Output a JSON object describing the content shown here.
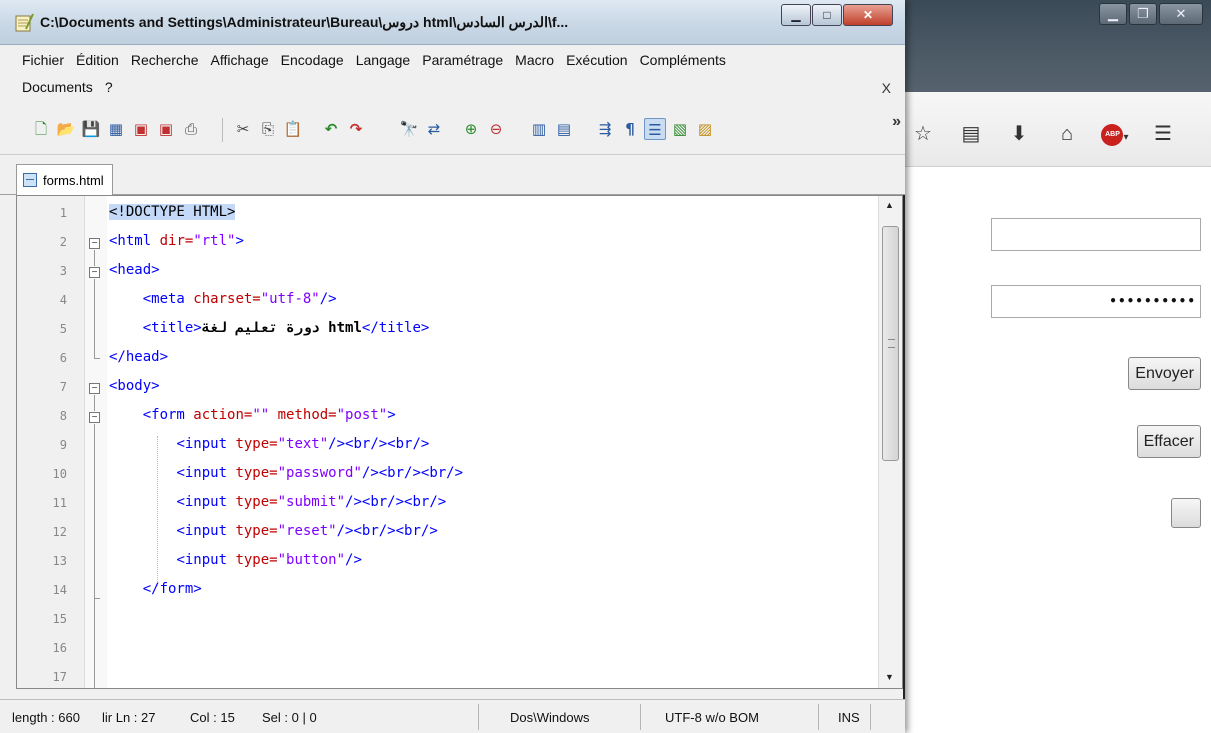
{
  "npp": {
    "title": "C:\\Documents and Settings\\Administrateur\\Bureau\\دروس html\\الدرس السادس\\f...",
    "menu_row1": [
      "Fichier",
      "Édition",
      "Recherche",
      "Affichage",
      "Encodage",
      "Langage",
      "Paramétrage",
      "Macro",
      "Exécution",
      "Compléments"
    ],
    "menu_row2": [
      "Documents",
      "?"
    ],
    "menu_close": "X",
    "toolbar_more": "»",
    "tab_label": "forms.html",
    "line_numbers": [
      "1",
      "2",
      "3",
      "4",
      "5",
      "6",
      "7",
      "8",
      "9",
      "10",
      "11",
      "12",
      "13",
      "14",
      "15",
      "16",
      "17"
    ],
    "code": {
      "l1": {
        "doctype": "<!DOCTYPE HTML>"
      },
      "l2": {
        "tag_open": "<html",
        "attr": " dir=",
        "val": "\"rtl\"",
        "tag_close": ">"
      },
      "l3": {
        "tag": "<head>"
      },
      "l4": {
        "tag_open": "<meta",
        "attr": " charset=",
        "val": "\"utf-8\"",
        "tag_close": "/>"
      },
      "l5": {
        "tag_open": "<title>",
        "text": "دورة تعليم لغة html",
        "tag_close": "</title>"
      },
      "l6": {
        "tag": "</head>"
      },
      "l7": {
        "tag": "<body>"
      },
      "l8": {
        "tag_open": "<form",
        "attr1": " action=",
        "val1": "\"\"",
        "attr2": " method=",
        "val2": "\"post\"",
        "tag_close": ">"
      },
      "l9": {
        "tag_open": "<input",
        "attr": " type=",
        "val": "\"text\"",
        "tag_close": "/><br/><br/>"
      },
      "l10": {
        "tag_open": "<input",
        "attr": " type=",
        "val": "\"password\"",
        "tag_close": "/><br/><br/>"
      },
      "l11": {
        "tag_open": "<input",
        "attr": " type=",
        "val": "\"submit\"",
        "tag_close": "/><br/><br/>"
      },
      "l12": {
        "tag_open": "<input",
        "attr": " type=",
        "val": "\"reset\"",
        "tag_close": "/><br/><br/>"
      },
      "l13": {
        "tag_open": "<input",
        "attr": " type=",
        "val": "\"button\"",
        "tag_close": "/>"
      },
      "l14": {
        "tag": "</form>"
      }
    },
    "status": {
      "length": "length : 660",
      "lines": "lir Ln : 27",
      "col": "Col : 15",
      "sel": "Sel : 0 | 0",
      "eol": "Dos\\Windows",
      "encoding": "UTF-8 w/o BOM",
      "mode": "INS"
    }
  },
  "browser": {
    "password_value": "••••••••••",
    "submit_label": "Envoyer",
    "reset_label": "Effacer",
    "icons": [
      "star-icon",
      "bookmarks-icon",
      "download-icon",
      "home-icon",
      "adblock-plus-icon",
      "menu-icon"
    ],
    "abp_label": "ABP"
  },
  "colors": {
    "tag": "#0000ff",
    "attribute": "#c00000",
    "value": "#8000ff"
  }
}
